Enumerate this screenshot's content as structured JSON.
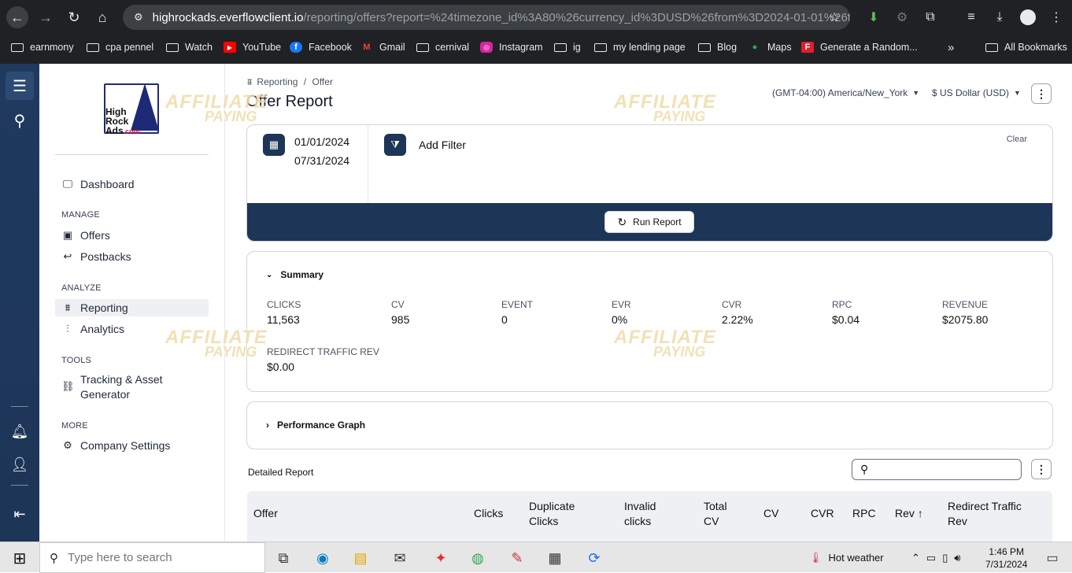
{
  "browser": {
    "url_host": "highrockads.everflowclient.io",
    "url_path": "/reporting/offers?report=%24timezone_id%3A80%26currency_id%3DUSD%26from%3D2024-01-01%26to...",
    "bookmarks": [
      "earnmony",
      "cpa pennel",
      "Watch",
      "YouTube",
      "Facebook",
      "Gmail",
      "cernival",
      "Instagram",
      "ig",
      "my lending page",
      "Blog",
      "Maps",
      "Generate a Random..."
    ],
    "all_bookmarks": "All Bookmarks",
    "overflow": "»"
  },
  "logo": {
    "line1": "High",
    "line2": "Rock",
    "line3": "Ads",
    "suffix": ".com"
  },
  "sidebar": {
    "dashboard": "Dashboard",
    "manage": "MANAGE",
    "offers": "Offers",
    "postbacks": "Postbacks",
    "analyze": "ANALYZE",
    "reporting": "Reporting",
    "analytics": "Analytics",
    "tools": "TOOLS",
    "tracking1": "Tracking & Asset",
    "tracking2": "Generator",
    "more": "MORE",
    "company": "Company Settings"
  },
  "header": {
    "crumb_root": "Reporting",
    "crumb_sep": "/",
    "crumb_leaf": "Offer",
    "title": "Offer Report",
    "timezone": "(GMT-04:00) America/New_York",
    "currency": "$ US Dollar (USD)"
  },
  "filter": {
    "date_from": "01/01/2024",
    "date_to": "07/31/2024",
    "add_filter": "Add Filter",
    "clear": "Clear",
    "run": "Run Report"
  },
  "summary": {
    "title": "Summary",
    "metrics": [
      {
        "label": "CLICKS",
        "value": "11,563"
      },
      {
        "label": "CV",
        "value": "985"
      },
      {
        "label": "EVENT",
        "value": "0"
      },
      {
        "label": "EVR",
        "value": "0%"
      },
      {
        "label": "CVR",
        "value": "2.22%"
      },
      {
        "label": "RPC",
        "value": "$0.04"
      },
      {
        "label": "REVENUE",
        "value": "$2075.80"
      },
      {
        "label": "REDIRECT TRAFFIC REV",
        "value": "$0.00"
      }
    ]
  },
  "graph": {
    "title": "Performance Graph"
  },
  "detailed": {
    "title": "Detailed Report",
    "search_placeholder": "",
    "columns": {
      "offer": "Offer",
      "clicks": "Clicks",
      "dup1": "Duplicate",
      "dup2": "Clicks",
      "inv1": "Invalid",
      "inv2": "clicks",
      "tot1": "Total",
      "tot2": "CV",
      "cv": "CV",
      "cvr": "CVR",
      "rpc": "RPC",
      "rev": "Rev ↑",
      "red1": "Redirect Traffic",
      "red2": "Rev"
    }
  },
  "watermark": {
    "line1": "AFFILIATE",
    "line2": "PAYING"
  },
  "taskbar": {
    "search_placeholder": "Type here to search",
    "weather": "Hot weather",
    "time": "1:46 PM",
    "date": "7/31/2024"
  }
}
